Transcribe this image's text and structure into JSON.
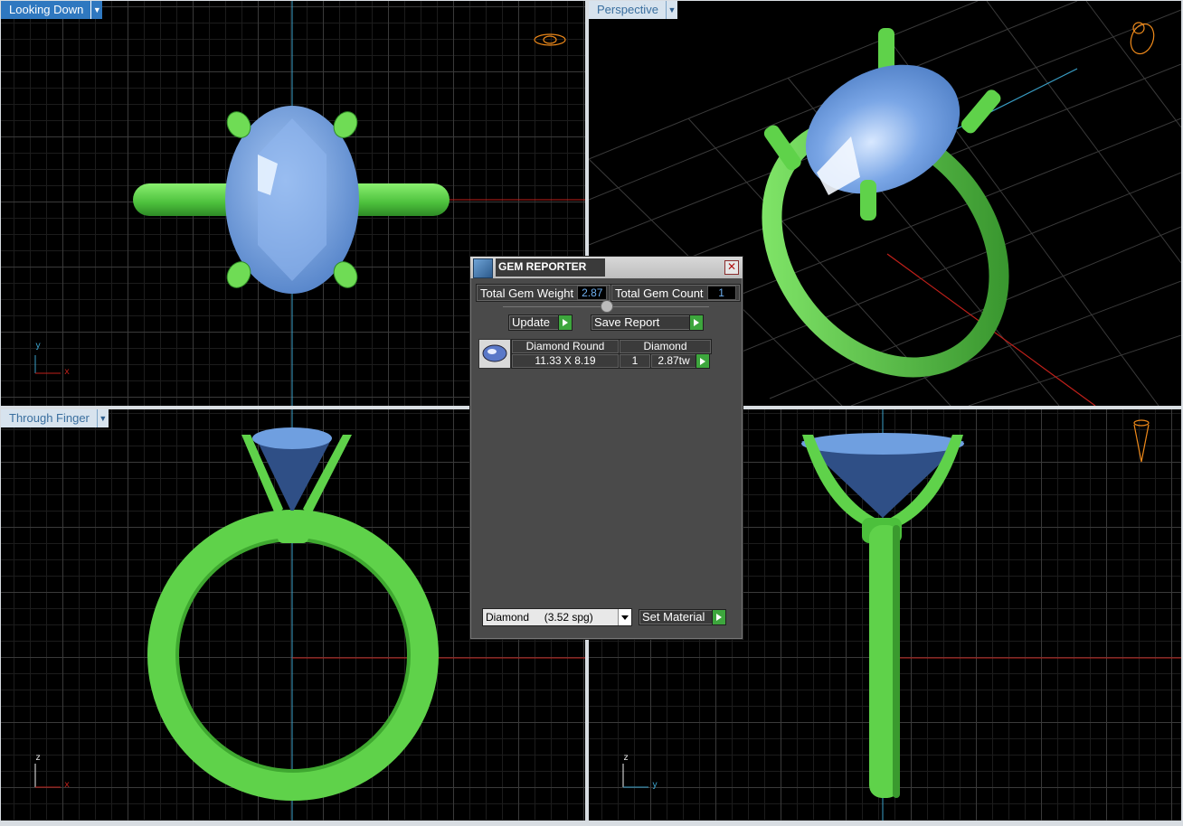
{
  "viewports": {
    "top": {
      "label": "Looking Down",
      "axis_v": "y",
      "axis_h": "x"
    },
    "perspective": {
      "label": "Perspective"
    },
    "front": {
      "label": "Through Finger",
      "axis_v": "z",
      "axis_h": "x"
    },
    "side": {
      "axis_v": "z",
      "axis_h": "y"
    }
  },
  "dialog": {
    "title": "GEM REPORTER",
    "close_glyph": "✕",
    "total_gem_weight_label": "Total Gem Weight",
    "total_gem_weight_value": "2.87",
    "total_gem_count_label": "Total Gem Count",
    "total_gem_count_value": "1",
    "update_label": "Update",
    "save_report_label": "Save Report",
    "table": {
      "col1_header": "Diamond Round",
      "col2_header": "Diamond",
      "rows": [
        {
          "size": "11.33 X 8.19",
          "count": "1",
          "weight": "2.87tw"
        }
      ]
    },
    "material_select": "Diamond     (3.52 spg)",
    "set_material_label": "Set Material"
  },
  "colors": {
    "metal": "#5fd24a",
    "gem": "#6f9fe0",
    "grid_major": "#3a3a3a",
    "axis_red": "#c0201a",
    "axis_cyan": "#3aa0c8",
    "label_active": "#2f78c0"
  },
  "icons": [
    "dropdown-arrow-icon",
    "close-icon",
    "play-arrow-icon",
    "view-cube-icon",
    "gem-thumbnail-icon"
  ]
}
